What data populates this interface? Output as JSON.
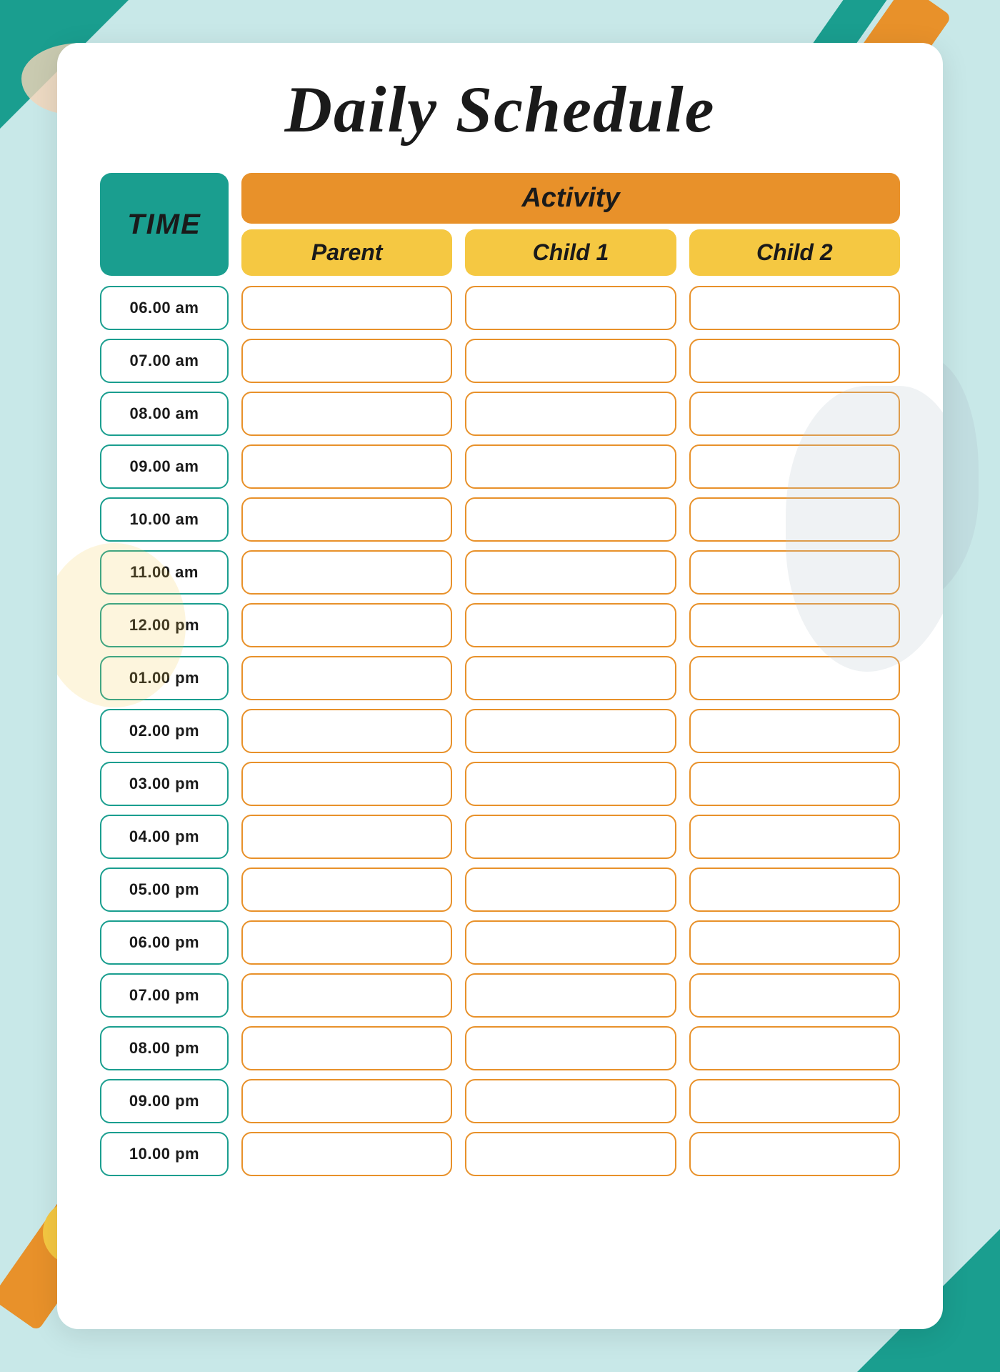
{
  "title": "Daily Schedule",
  "time_header": "TIME",
  "activity_header": "Activity",
  "sub_headers": {
    "parent": "Parent",
    "child1": "Child 1",
    "child2": "Child 2"
  },
  "time_slots": [
    "06.00 am",
    "07.00 am",
    "08.00 am",
    "09.00 am",
    "10.00 am",
    "11.00 am",
    "12.00 pm",
    "01.00 pm",
    "02.00 pm",
    "03.00 pm",
    "04.00 pm",
    "05.00 pm",
    "06.00 pm",
    "07.00 pm",
    "08.00 pm",
    "09.00 pm",
    "10.00 pm"
  ]
}
